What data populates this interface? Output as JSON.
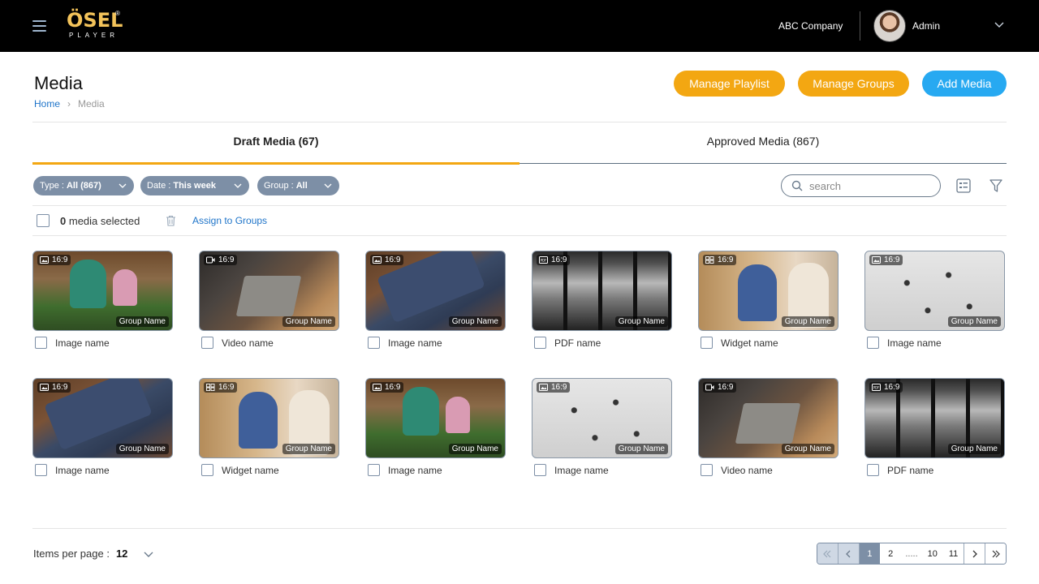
{
  "topbar": {
    "logo_main": "ÖSEL",
    "logo_sub": "PLAYER",
    "logo_reg": "®",
    "company": "ABC Company",
    "user_name": "Admin"
  },
  "header": {
    "title": "Media",
    "breadcrumb_home": "Home",
    "breadcrumb_current": "Media",
    "manage_playlist": "Manage Playlist",
    "manage_groups": "Manage Groups",
    "add_media": "Add Media"
  },
  "tabs": {
    "draft": "Draft Media (67)",
    "approved": "Approved Media (867)",
    "active": "draft"
  },
  "filters": {
    "type_label": "Type :",
    "type_value": "All (867)",
    "date_label": "Date :",
    "date_value": "This week",
    "group_label": "Group :",
    "group_value": "All",
    "search_placeholder": "search"
  },
  "selection": {
    "count": "0",
    "suffix": "media selected",
    "assign": "Assign to Groups"
  },
  "media": [
    {
      "ratio": "16:9",
      "icon": "image-icon",
      "group": "Group Name",
      "name": "Image name",
      "photo": "p-family"
    },
    {
      "ratio": "16:9",
      "icon": "video-icon",
      "group": "Group Name",
      "name": "Video name",
      "photo": "p-laptop"
    },
    {
      "ratio": "16:9",
      "icon": "image-icon",
      "group": "Group Name",
      "name": "Image name",
      "photo": "p-keys"
    },
    {
      "ratio": "16:9",
      "icon": "pdf-icon",
      "group": "Group Name",
      "name": "PDF name",
      "photo": "p-city"
    },
    {
      "ratio": "16:9",
      "icon": "widget-icon",
      "group": "Group Name",
      "name": "Widget name",
      "photo": "p-meeting"
    },
    {
      "ratio": "16:9",
      "icon": "image-icon",
      "group": "Group Name",
      "name": "Image name",
      "photo": "p-crowd"
    },
    {
      "ratio": "16:9",
      "icon": "image-icon",
      "group": "Group Name",
      "name": "Image name",
      "photo": "p-keys"
    },
    {
      "ratio": "16:9",
      "icon": "widget-icon",
      "group": "Group Name",
      "name": "Widget name",
      "photo": "p-meeting"
    },
    {
      "ratio": "16:9",
      "icon": "image-icon",
      "group": "Group Name",
      "name": "Image name",
      "photo": "p-family"
    },
    {
      "ratio": "16:9",
      "icon": "image-icon",
      "group": "Group Name",
      "name": "Image name",
      "photo": "p-crowd"
    },
    {
      "ratio": "16:9",
      "icon": "video-icon",
      "group": "Group Name",
      "name": "Video name",
      "photo": "p-laptop"
    },
    {
      "ratio": "16:9",
      "icon": "pdf-icon",
      "group": "Group Name",
      "name": "PDF name",
      "photo": "p-city"
    }
  ],
  "footer": {
    "items_per_page_label": "Items per page :",
    "items_per_page_value": "12",
    "pages": [
      "1",
      "2",
      ".....",
      "10",
      "11"
    ],
    "current_page": "1"
  },
  "colors": {
    "accent_orange": "#f3a712",
    "accent_blue": "#27a9f1",
    "chip_gray": "#7d8fa6",
    "link_blue": "#1e74c9"
  }
}
